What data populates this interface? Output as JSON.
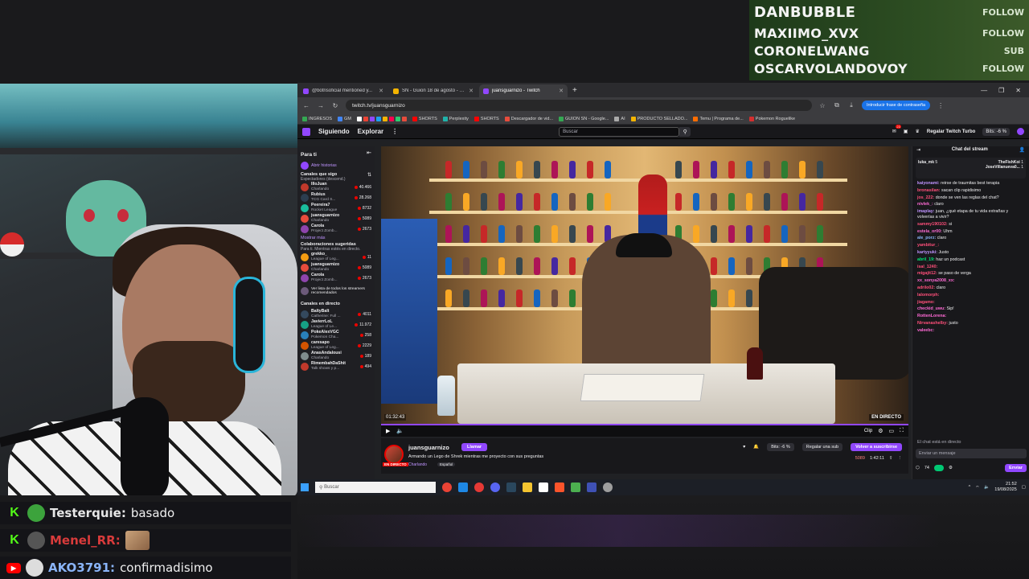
{
  "alerts": [
    {
      "name": "DANBUBBLE",
      "type": "FOLLOW"
    },
    {
      "name": "MAXIIMO_XVX",
      "type": "FOLLOW"
    },
    {
      "name": "CORONELWANG",
      "type": "SUB"
    },
    {
      "name": "OSCARVOLANDOVOY",
      "type": "FOLLOW"
    }
  ],
  "stream_chat": [
    {
      "user": "Testerquie:",
      "message": "basado",
      "user_color": "#e6e6e6",
      "badge": "K"
    },
    {
      "user": "Menel_RR:",
      "message": "",
      "user_color": "#d83b3b",
      "badge": "K"
    },
    {
      "user": "AKO3791:",
      "message": "confirmadisimo",
      "user_color": "#8ab4f8",
      "badge": "▶"
    }
  ],
  "browser": {
    "tabs": [
      {
        "label": "@botrisoficial mentioned y...",
        "color": "#9147ff"
      },
      {
        "label": "SN - Guion 18 de agosto - Pre...",
        "color": "#f4b400"
      },
      {
        "label": "juansguarnizo - Twitch",
        "color": "#9147ff",
        "active": true
      }
    ],
    "url": "twitch.tv/juansguarnizo",
    "password_pill": "Introducir frase de contraseña",
    "bookmarks": [
      "INGRESOS",
      "GM",
      "SHORTS",
      "Perplexity",
      "SHORTS",
      "Descargador de vid...",
      "GUION SN - Google...",
      "AI",
      "PRODUCTO SELLADO...",
      "Temu | Programa de...",
      "Pokemon Roguelike"
    ]
  },
  "twitch": {
    "nav": {
      "following": "Siguiendo",
      "explore": "Explorar",
      "search_placeholder": "Buscar",
      "turbo": "Regalar Twitch Turbo",
      "bits": "Bits: -6 %",
      "notif_count": "23"
    },
    "sidebar": {
      "title": "Para ti",
      "stories": "Abrir historias",
      "followed_title": "Canales que sigo",
      "followed_sub": "Espectadores (descend.)",
      "followed": [
        {
          "name": "IlloJuan",
          "game": "Charlando",
          "viewers": "40.466",
          "color": "#c0392b"
        },
        {
          "name": "Rubius",
          "game": "TCG Card S...",
          "viewers": "28.268",
          "color": "#2c3e50"
        },
        {
          "name": "Peereira7",
          "game": "Rocket League",
          "viewers": "8732",
          "color": "#1abc9c"
        },
        {
          "name": "juansguarnizo",
          "game": "Charlando",
          "viewers": "5089",
          "color": "#e74c3c"
        },
        {
          "name": "Carola",
          "game": "Project Zomb...",
          "viewers": "2673",
          "color": "#8e44ad"
        }
      ],
      "show_more": "Mostrar más",
      "collab_title": "Colaboraciones sugeridas",
      "collab_sub": "Para ti. Mientras estés en directo.",
      "collabs": [
        {
          "name": "grekko_",
          "game": "League of Leg...",
          "viewers": "11",
          "color": "#f39c12"
        },
        {
          "name": "juansguarnizo",
          "game": "Charlando",
          "viewers": "5089",
          "color": "#e74c3c"
        },
        {
          "name": "Carola",
          "game": "Project Zomb...",
          "viewers": "2673",
          "color": "#8e44ad"
        }
      ],
      "recommended_all": "Ver lista de todos los streamers recomendados",
      "live_title": "Canales en directo",
      "live": [
        {
          "name": "BaltyBalt",
          "game": "Catherine: Full ...",
          "viewers": "4011",
          "color": "#34495e"
        },
        {
          "name": "JavierrLoL",
          "game": "League of Le...",
          "viewers": "11.972",
          "color": "#16a085"
        },
        {
          "name": "PokeAlexVGC",
          "game": "Pokemon Cha...",
          "viewers": "258",
          "color": "#2980b9"
        },
        {
          "name": "caresapo",
          "game": "League of Leg...",
          "viewers": "2229",
          "color": "#d35400"
        },
        {
          "name": "AnasAndalousi",
          "game": "Charlando",
          "viewers": "189",
          "color": "#7f8c8d"
        },
        {
          "name": "RimembahDaShit",
          "game": "Talk shows y p...",
          "viewers": "494",
          "color": "#c0392b"
        }
      ]
    },
    "player": {
      "time": "01:32:43",
      "live": "EN DIRECTO",
      "clip": "Clip"
    },
    "info": {
      "channel": "juansguarnizo",
      "call": "Llamar",
      "title": "Armando un Lego de Shrek mientras me proyecto con sus preguntas",
      "category": "Charlando",
      "tag": "Español",
      "live_tag": "EN DIRECTO",
      "bits": "Bits: -6 %",
      "gift": "Regalar una sub",
      "resub": "Volver a suscribirse",
      "viewers": "5089",
      "uptime": "1:42:11"
    },
    "chat": {
      "title": "Chat del stream",
      "gifts": [
        {
          "user": "luka_mk",
          "count": "5"
        },
        {
          "user": "TheFishKoi",
          "count": "1"
        },
        {
          "user": "JoseVillanueva0...",
          "count": "1"
        }
      ],
      "messages": [
        {
          "user": "kaiyonami:",
          "text": "reirse de traumitas best terapia",
          "color": "#bf94ff"
        },
        {
          "user": "bronasilan:",
          "text": "sacan clip rapidisimo",
          "color": "#ff4f7a"
        },
        {
          "user": "jos_222:",
          "text": "donde se ven las reglas del chat?",
          "color": "#ff4f7a"
        },
        {
          "user": "nivlek_:",
          "text": "claro",
          "color": "#ff6ad5"
        },
        {
          "user": "imaplay:",
          "text": "juan, ¿qué etapa de tu vida extrañas y volverías a vivir?",
          "color": "#bf94ff"
        },
        {
          "user": "sammy190102:",
          "text": "si",
          "color": "#ff4f7a"
        },
        {
          "user": "estela_or00:",
          "text": "Uhm",
          "color": "#ff6ad5"
        },
        {
          "user": "ale_porz:",
          "text": "claro",
          "color": "#8ab4f8"
        },
        {
          "user": "yambitur_:",
          "text": "",
          "color": "#ff4f7a"
        },
        {
          "user": "kartyyuki:",
          "text": "Justo",
          "color": "#bf94ff"
        },
        {
          "user": "abril_19:",
          "text": "haz un podcast",
          "color": "#00e676"
        },
        {
          "user": "isal_1240:",
          "text": "",
          "color": "#ff4f7a"
        },
        {
          "user": "migajit12:",
          "text": "se paso de verga",
          "color": "#ff4f7a"
        },
        {
          "user": "xx_sonya2008_xx:",
          "text": "",
          "color": "#ff6ad5"
        },
        {
          "user": "adrilo02:",
          "text": "claro",
          "color": "#ff4f7a"
        },
        {
          "user": "lalomorph:",
          "text": "",
          "color": "#ff4f7a"
        },
        {
          "user": "jiagamo:",
          "text": "",
          "color": "#ff4f7a"
        },
        {
          "user": "checkid_uwu:",
          "text": "Sip!",
          "color": "#ff6ad5"
        },
        {
          "user": "RottenLorena:",
          "text": "",
          "color": "#ff6ad5"
        },
        {
          "user": "Nirvanashelby:",
          "text": "justo",
          "color": "#ff4f7a"
        },
        {
          "user": "valeebc:",
          "text": "",
          "color": "#ff6ad5"
        }
      ],
      "welcome": "El chat está en directo",
      "input_placeholder": "Enviar un mensaje",
      "points": "74",
      "send": "Enviar"
    },
    "taskbar": {
      "search": "Buscar",
      "time": "21:52",
      "date": "19/08/2025"
    }
  }
}
